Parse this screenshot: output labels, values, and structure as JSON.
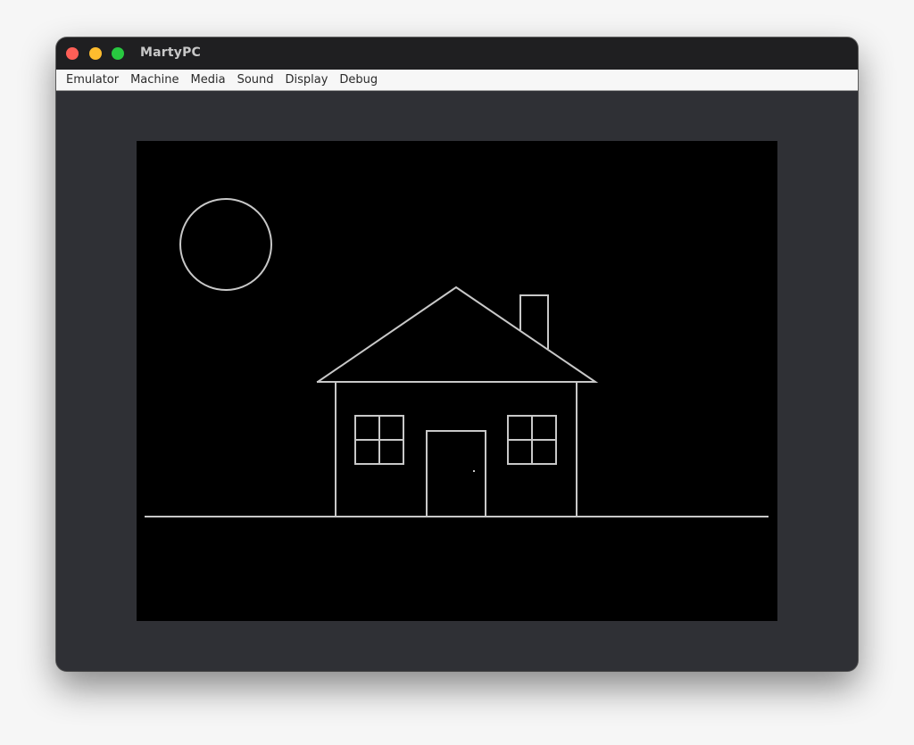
{
  "window": {
    "title": "MartyPC",
    "controls": {
      "close": "close-icon",
      "minimize": "minimize-icon",
      "maximize": "maximize-icon"
    }
  },
  "menubar": {
    "items": [
      {
        "label": "Emulator"
      },
      {
        "label": "Machine"
      },
      {
        "label": "Media"
      },
      {
        "label": "Sound"
      },
      {
        "label": "Display"
      },
      {
        "label": "Debug"
      }
    ]
  },
  "colors": {
    "screen_background": "#000000",
    "drawing_stroke": "#c8c8c8",
    "window_background": "#2f3035",
    "titlebar": "#1f1f21",
    "menubar": "#f7f7f7"
  },
  "emulator_screen": {
    "content": "line drawing of a house with chimney, door, two windows, sun, and ground line"
  }
}
